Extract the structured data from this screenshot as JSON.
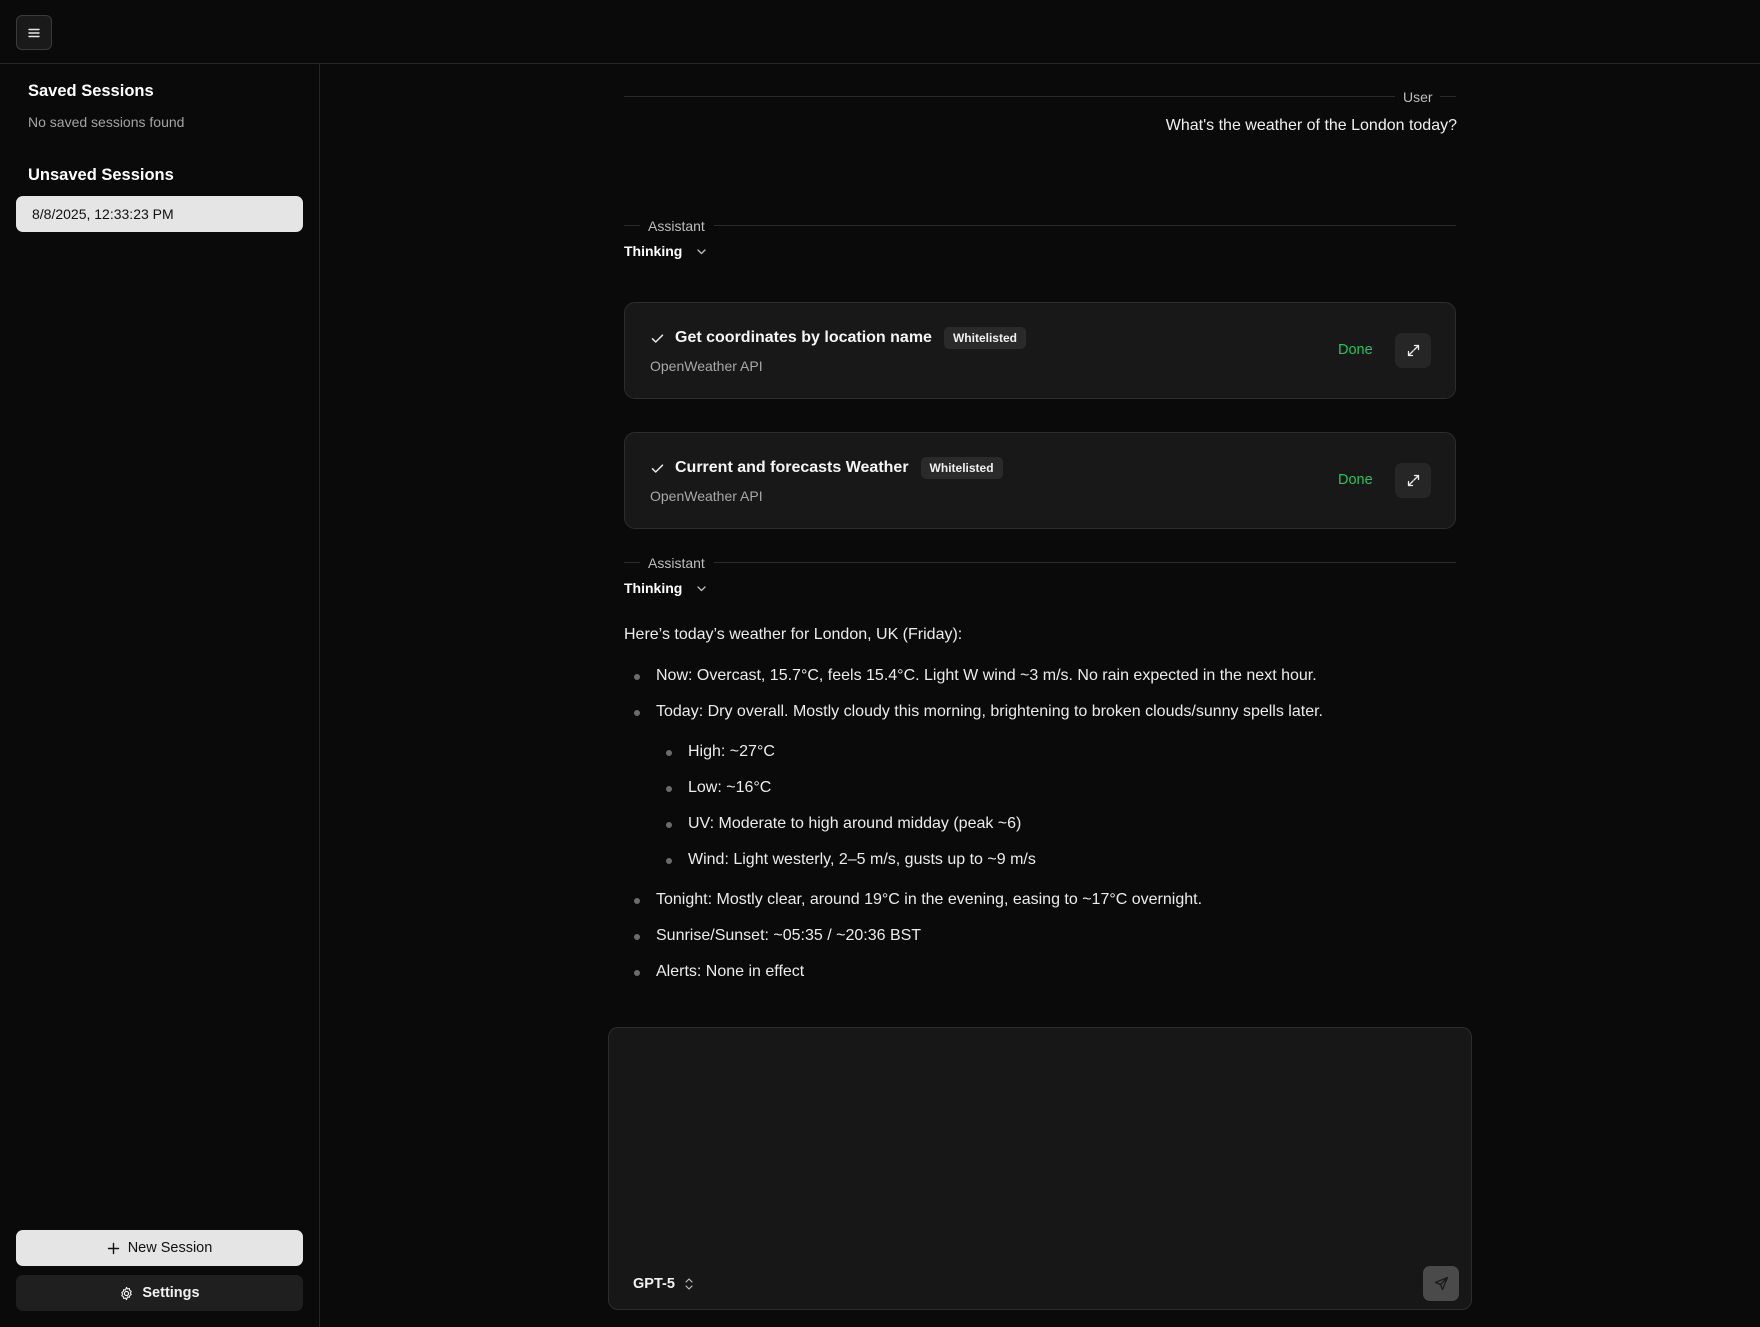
{
  "sidebar": {
    "saved_title": "Saved Sessions",
    "saved_empty": "No saved sessions found",
    "unsaved_title": "Unsaved Sessions",
    "unsaved_items": [
      "8/8/2025, 12:33:23 PM"
    ],
    "new_session_label": "New Session",
    "settings_label": "Settings"
  },
  "conversation": {
    "user_role": "User",
    "user_message": "What's the weather of the London today?",
    "assistant_role": "Assistant",
    "thinking_label": "Thinking",
    "tool_calls": [
      {
        "title": "Get coordinates by location name",
        "badge": "Whitelisted",
        "source": "OpenWeather API",
        "status": "Done"
      },
      {
        "title": "Current and forecasts Weather",
        "badge": "Whitelisted",
        "source": "OpenWeather API",
        "status": "Done"
      }
    ],
    "answer": {
      "intro": "Here’s today’s weather for London, UK (Friday):",
      "now": "Now: Overcast, 15.7°C, feels 15.4°C. Light W wind ~3 m/s. No rain expected in the next hour.",
      "today": "Today: Dry overall. Mostly cloudy this morning, brightening to broken clouds/sunny spells later.",
      "today_details": [
        "High: ~27°C",
        "Low: ~16°C",
        "UV: Moderate to high around midday (peak ~6)",
        "Wind: Light westerly, 2–5 m/s, gusts up to ~9 m/s"
      ],
      "tonight": "Tonight: Mostly clear, around 19°C in the evening, easing to ~17°C overnight.",
      "sun": "Sunrise/Sunset: ~05:35 / ~20:36 BST",
      "alerts": "Alerts: None in effect"
    }
  },
  "composer": {
    "input_value": "",
    "model": "GPT-5"
  },
  "colors": {
    "background": "#0a0a0a",
    "status_done": "#22c55e",
    "card": "#181818"
  },
  "icons": [
    "menu-icon",
    "check-icon",
    "chevron-down-icon",
    "expand-icon",
    "plus-icon",
    "gear-icon",
    "chevron-up-down-icon",
    "send-icon"
  ]
}
